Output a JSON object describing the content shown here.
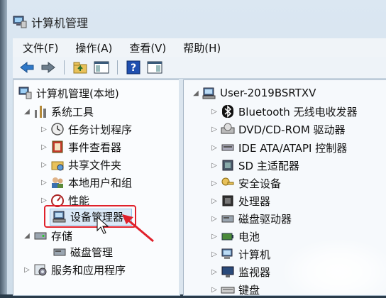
{
  "window": {
    "title": "计算机管理"
  },
  "menu": [
    "文件(F)",
    "操作(A)",
    "查看(V)",
    "帮助(H)"
  ],
  "left_tree": {
    "root": "计算机管理(本地)",
    "system_tools": "系统工具",
    "items": [
      "任务计划程序",
      "事件查看器",
      "共享文件夹",
      "本地用户和组",
      "性能",
      "设备管理器"
    ],
    "storage": "存储",
    "disk_mgmt": "磁盘管理",
    "services": "服务和应用程序"
  },
  "right_tree": {
    "root": "User-2019BSRTXV",
    "devices": [
      "Bluetooth 无线电收发器",
      "DVD/CD-ROM 驱动器",
      "IDE ATA/ATAPI 控制器",
      "SD 主适配器",
      "安全设备",
      "处理器",
      "磁盘驱动器",
      "电池",
      "计算机",
      "监视器",
      "键盘"
    ]
  },
  "colors": {
    "highlight": "#e0212b",
    "selection": "#dbe9f7"
  }
}
